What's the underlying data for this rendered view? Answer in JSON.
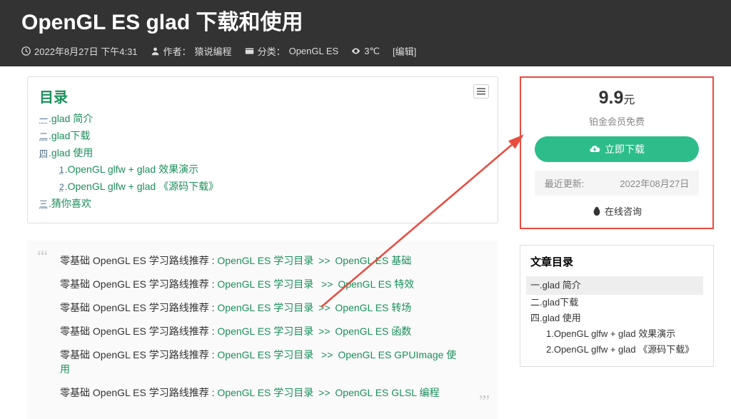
{
  "header": {
    "title": "OpenGL ES glad 下载和使用",
    "date": "2022年8月27日 下午4:31",
    "author_label": "作者：",
    "author": "猿说编程",
    "category_label": "分类：",
    "category": "OpenGL ES",
    "views": "3℃",
    "edit": "[编辑]"
  },
  "toc": {
    "title": "目录",
    "items": [
      {
        "num": "一",
        "text": ".glad 简介"
      },
      {
        "num": "二",
        "text": ".glad下载"
      },
      {
        "num": "四",
        "text": ".glad 使用"
      }
    ],
    "subs": [
      {
        "num": "1",
        "text": ".OpenGL glfw + glad 效果演示"
      },
      {
        "num": "2",
        "text": ".OpenGL glfw + glad 《源码下载》"
      }
    ],
    "last": {
      "num": "三",
      "text": ".猜你喜欢"
    }
  },
  "paths": {
    "lead": "零基础 OpenGL ES 学习路线推荐 : ",
    "link_hub": "OpenGL ES 学习目录",
    "sep": ">>",
    "targets": [
      "OpenGL ES 基础",
      "OpenGL ES 特效",
      "OpenGL ES 转场",
      "OpenGL ES 函数",
      "OpenGL ES GPUImage 使用",
      "OpenGL ES GLSL 编程"
    ]
  },
  "download": {
    "price": "9.9",
    "currency": "元",
    "free_text": "铂金会员免费",
    "button": "立即下载",
    "update_label": "最近更新:",
    "update_date": "2022年08月27日",
    "consult": "在线咨询"
  },
  "side_toc": {
    "title": "文章目录",
    "items": [
      {
        "text": "一.glad 简介",
        "active": true
      },
      {
        "text": "二.glad下载"
      },
      {
        "text": "四.glad 使用"
      },
      {
        "text": "1.OpenGL glfw + glad 效果演示",
        "sub": true
      },
      {
        "text": "2.OpenGL glfw + glad 《源码下载》",
        "sub": true
      }
    ]
  }
}
